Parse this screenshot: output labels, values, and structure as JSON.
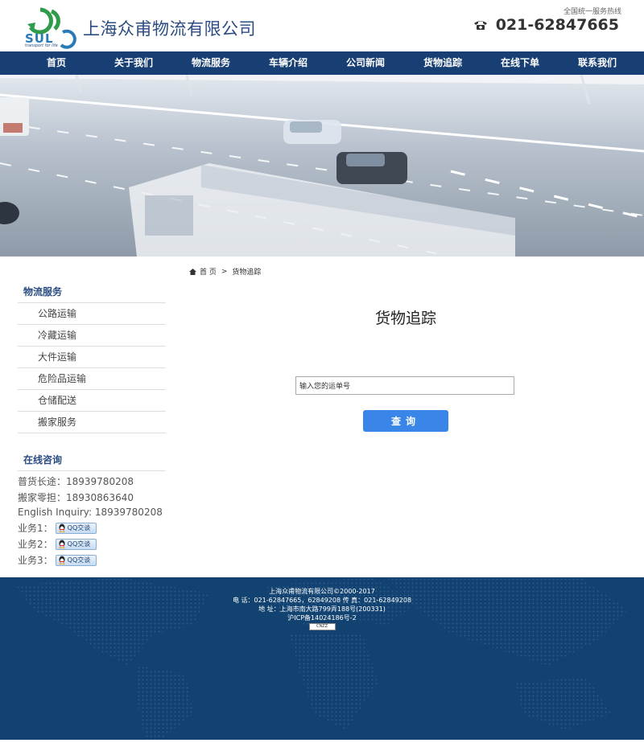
{
  "header": {
    "logo_text": "SUL",
    "logo_slogan": "transport for life",
    "company_name": "上海众甫物流有限公司",
    "hotline_label": "全国统一服务热线",
    "hotline_number": "021-62847665"
  },
  "nav": {
    "items": [
      {
        "label": "首页"
      },
      {
        "label": "关于我们"
      },
      {
        "label": "物流服务"
      },
      {
        "label": "车辆介绍"
      },
      {
        "label": "公司新闻"
      },
      {
        "label": "货物追踪"
      },
      {
        "label": "在线下单"
      },
      {
        "label": "联系我们"
      }
    ]
  },
  "breadcrumb": {
    "home": "首 页",
    "separator": ">",
    "current": "货物追踪"
  },
  "sidebar": {
    "title": "物流服务",
    "items": [
      {
        "label": "公路运输"
      },
      {
        "label": "冷藏运输"
      },
      {
        "label": "大件运输"
      },
      {
        "label": "危险品运输"
      },
      {
        "label": "仓储配送"
      },
      {
        "label": "搬家服务"
      }
    ],
    "consult_title": "在线咨询",
    "contacts": [
      {
        "text": "普货长途：18939780208"
      },
      {
        "text": "搬家零担：18930863640"
      },
      {
        "text": "English Inquiry: 18939780208"
      }
    ],
    "qq": [
      {
        "label": "业务1：",
        "button": "QQ交谈"
      },
      {
        "label": "业务2：",
        "button": "QQ交谈"
      },
      {
        "label": "业务3：",
        "button": "QQ交谈"
      }
    ]
  },
  "main": {
    "title": "货物追踪",
    "input_value": "输入您的运单号",
    "button_label": "查询"
  },
  "footer": {
    "copyright": "上海众甫物流有限公司©2000-2017",
    "phone": "电 话：021-62847665，62849208 传 真：021-62849208",
    "address": "地 址：上海市南大路799弄188号(200331)",
    "icp": "沪ICP备14024186号-2",
    "cnzz": "CNZZ"
  },
  "colors": {
    "nav_bg": "#173f74",
    "title_blue": "#2b4c83",
    "button_blue": "#3a86e8",
    "footer_bg": "#12426f"
  }
}
